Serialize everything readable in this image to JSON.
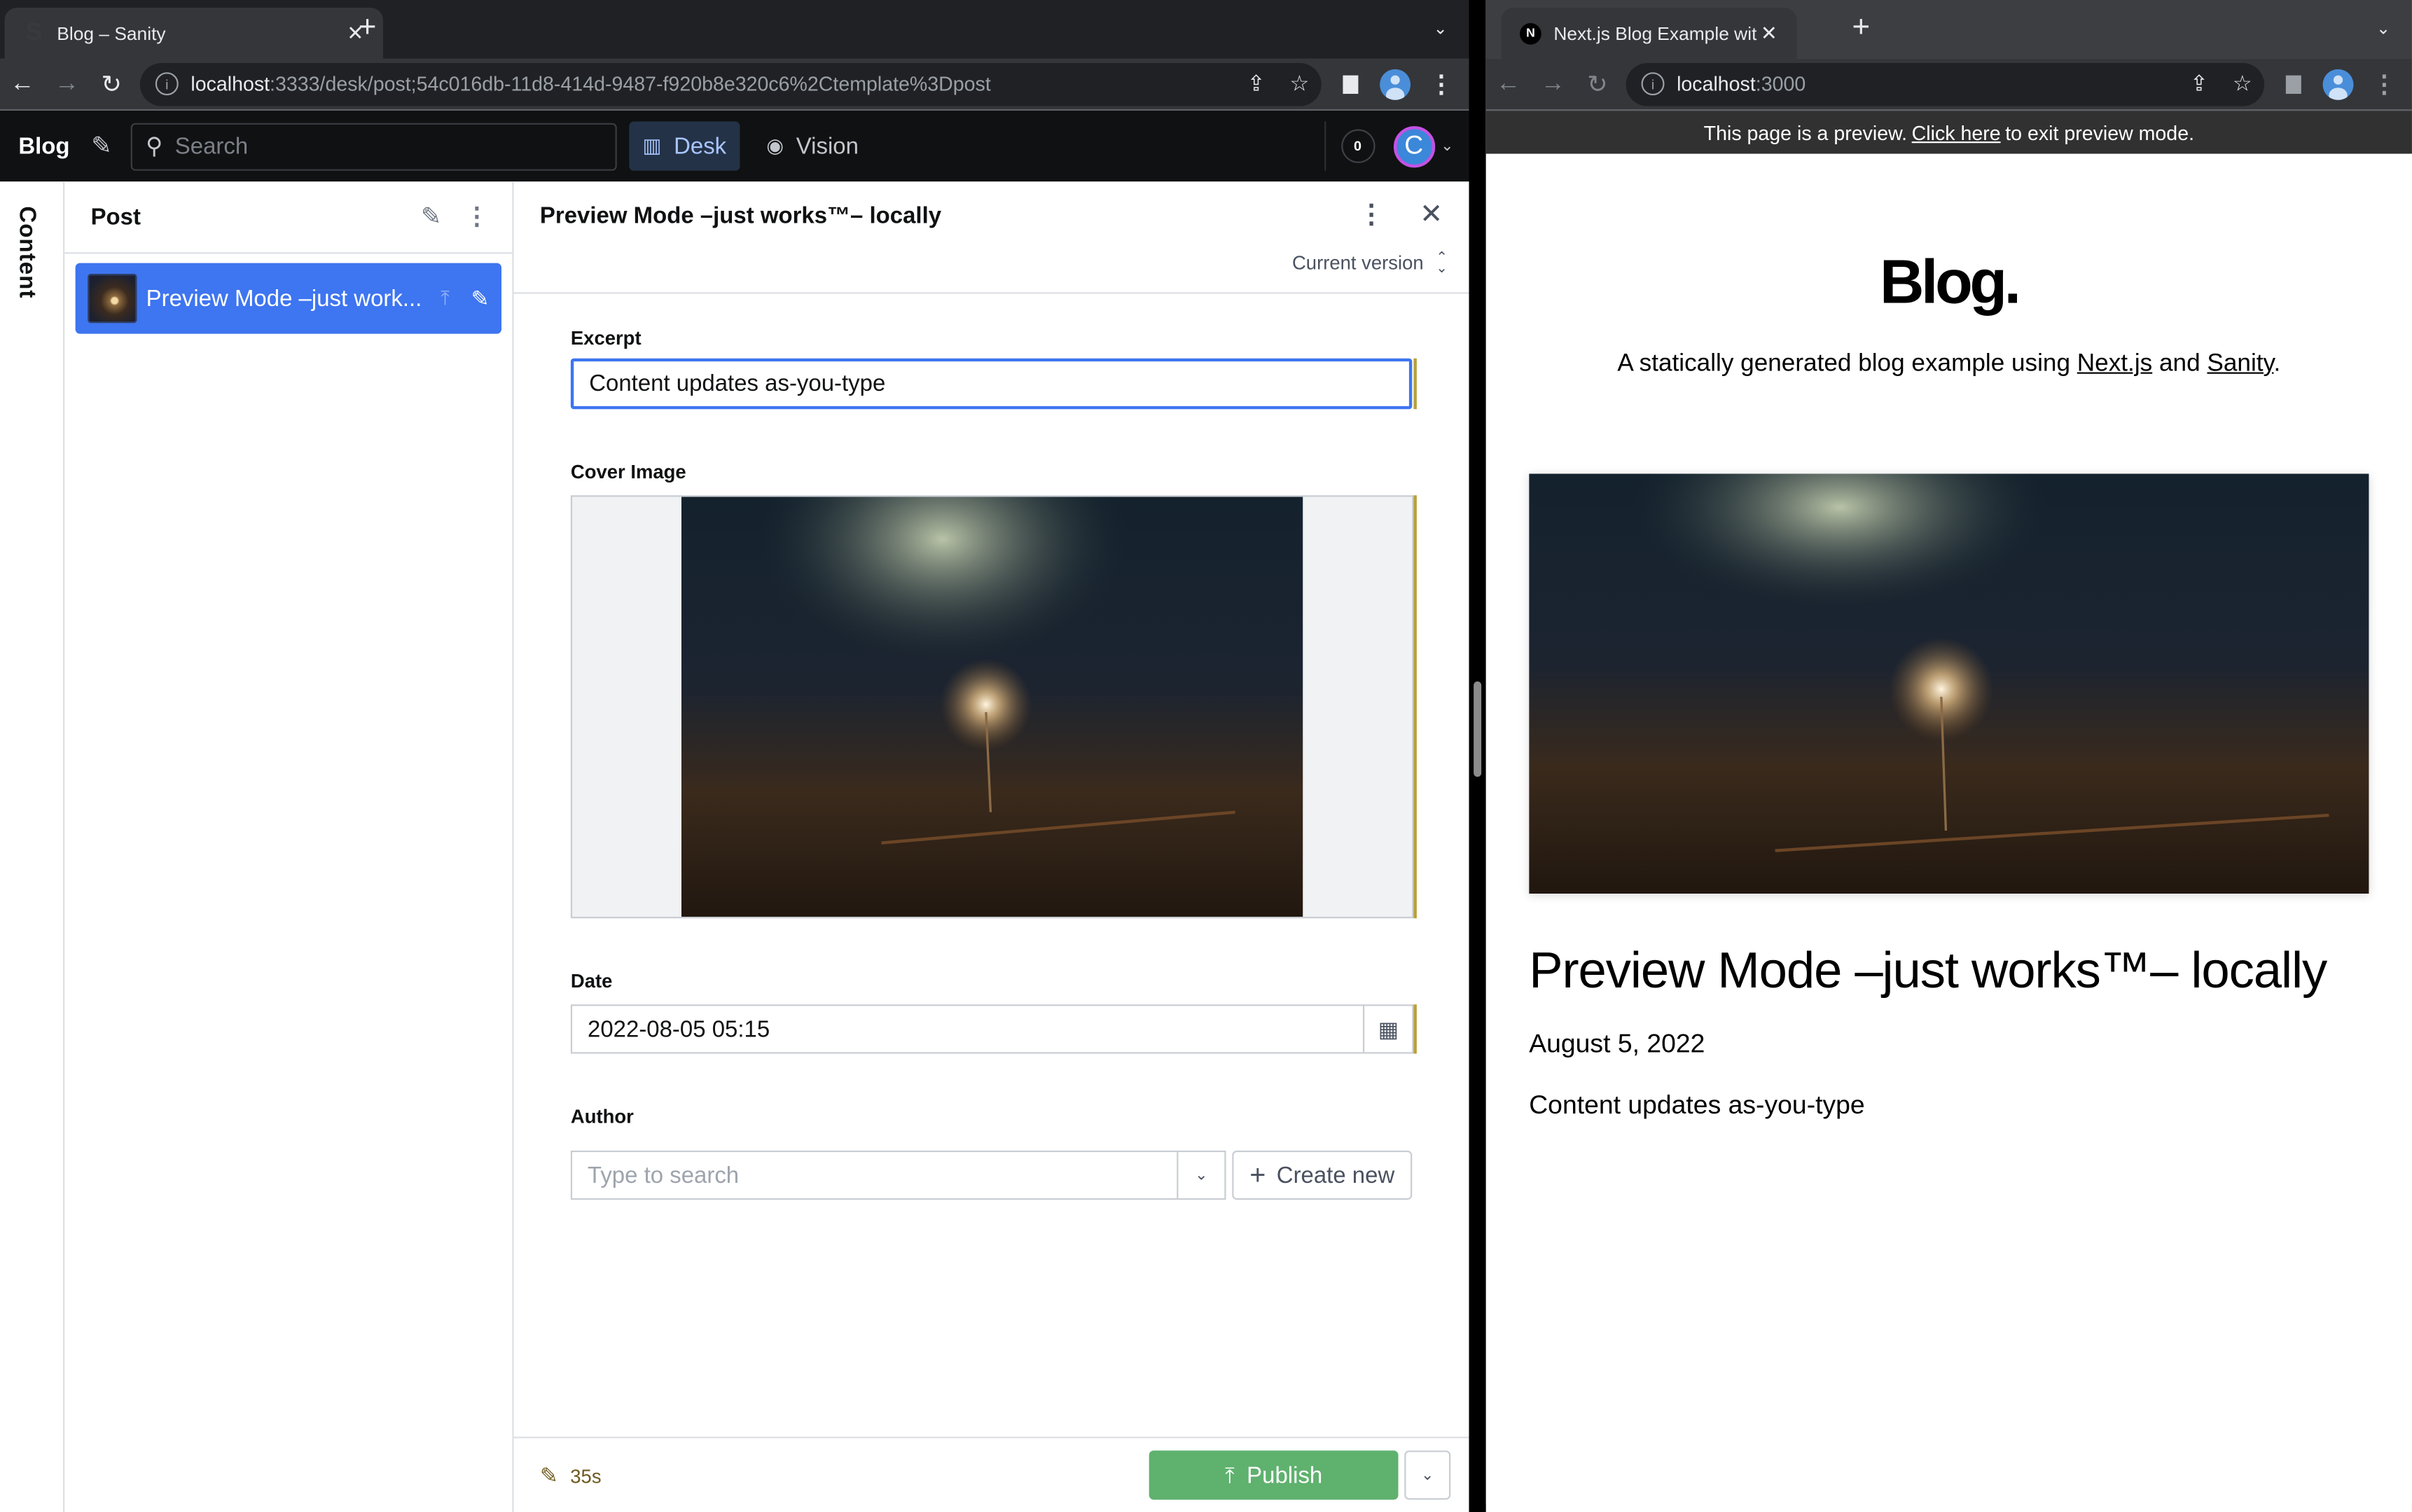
{
  "left_browser": {
    "tab": {
      "favicon": "sanity-favicon",
      "title": "Blog – Sanity"
    },
    "url": {
      "host": "localhost",
      "path": ":3333/desk/post;54c016db-11d8-414d-9487-f920b8e320c6%2Ctemplate%3Dpost"
    }
  },
  "right_browser": {
    "tab": {
      "favicon": "nextjs-favicon",
      "title": "Next.js Blog Example with Sanity"
    },
    "url": {
      "host": "localhost",
      "path": ":3000"
    }
  },
  "studio": {
    "brand": "Blog",
    "search_placeholder": "Search",
    "tools": [
      {
        "label": "Desk",
        "active": true
      },
      {
        "label": "Vision",
        "active": false
      }
    ],
    "notification_count": "0",
    "user_initial": "C",
    "rail_label": "Content",
    "list_pane": {
      "title": "Post",
      "items": [
        {
          "title": "Preview Mode –just work...",
          "selected": true
        }
      ]
    },
    "document": {
      "title": "Preview Mode –just works™– locally",
      "version": "Current version",
      "fields": {
        "excerpt": {
          "label": "Excerpt",
          "value": "Content updates as-you-type"
        },
        "cover_image": {
          "label": "Cover Image"
        },
        "date": {
          "label": "Date",
          "value": "2022-08-05 05:15"
        },
        "author": {
          "label": "Author",
          "placeholder": "Type to search",
          "create_label": "Create new"
        }
      },
      "footer": {
        "edited_ago": "35s",
        "publish_label": "Publish"
      }
    },
    "colors": {
      "accent": "#3e75f0",
      "publish": "#5fb16e",
      "changed": "#b8a03a"
    }
  },
  "preview": {
    "banner": {
      "prefix": "This page is a preview.",
      "link": "Click here",
      "suffix": "to exit preview mode."
    },
    "site_title": "Blog.",
    "tagline": {
      "prefix": "A statically generated blog example using",
      "link1": "Next.js",
      "mid": "and",
      "link2": "Sanity",
      "end": "."
    },
    "post": {
      "title": "Preview Mode –just works™– locally",
      "date": "August 5, 2022",
      "excerpt": "Content updates as-you-type"
    }
  }
}
